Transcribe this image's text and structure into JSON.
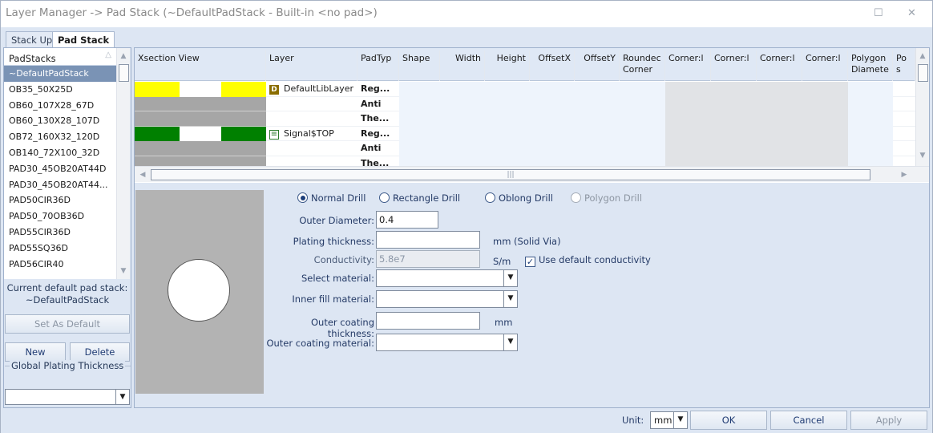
{
  "window": {
    "title": "Layer Manager -> Pad Stack (~DefaultPadStack - Built-in <no pad>)",
    "minimize_icon": "minimize-icon",
    "close_icon": "close-icon"
  },
  "tabs": [
    {
      "label": "Stack Up",
      "active": false
    },
    {
      "label": "Pad Stack",
      "active": true
    }
  ],
  "padstacks": {
    "header": "PadStacks",
    "items": [
      "~DefaultPadStack",
      "OB35_50X25D",
      "OB60_107X28_67D",
      "OB60_130X28_107D",
      "OB72_160X32_120D",
      "OB140_72X100_32D",
      "PAD30_45OB20AT44D",
      "PAD30_45OB20AT44...",
      "PAD50CIR36D",
      "PAD50_70OB36D",
      "PAD55CIR36D",
      "PAD55SQ36D",
      "PAD56CIR40"
    ],
    "selected_index": 0,
    "current_default_label": "Current default pad stack:",
    "current_default_value": "~DefaultPadStack",
    "set_default_label": "Set As Default",
    "new_label": "New",
    "delete_label": "Delete",
    "global_plating_label": "Global Plating Thickness",
    "global_plating_value": ""
  },
  "grid": {
    "columns": [
      "Xsection View",
      "Layer",
      "PadTyp",
      "Shape",
      "Width",
      "Height",
      "OffsetX",
      "OffsetY",
      "Roundec Corner",
      "Corner:l",
      "Corner:l",
      "Corner:l",
      "Corner:l",
      "Polygon Diamete",
      "Po s"
    ],
    "rows": [
      {
        "layer": "DefaultLibLayer",
        "layer_badge": "D",
        "padtype": "Reg...",
        "xsection_color": "#ffff00"
      },
      {
        "layer": "",
        "layer_badge": "",
        "padtype": "Anti",
        "xsection_color": "#a6a6a6"
      },
      {
        "layer": "",
        "layer_badge": "",
        "padtype": "The...",
        "xsection_color": "#a6a6a6"
      },
      {
        "layer": "Signal$TOP",
        "layer_badge": "≡",
        "padtype": "Reg...",
        "xsection_color": "#008000"
      },
      {
        "layer": "",
        "layer_badge": "",
        "padtype": "Anti",
        "xsection_color": "#a6a6a6"
      },
      {
        "layer": "",
        "layer_badge": "",
        "padtype": "The...",
        "xsection_color": "#a6a6a6"
      }
    ]
  },
  "drill": {
    "options": [
      {
        "label": "Normal Drill",
        "checked": true,
        "enabled": true
      },
      {
        "label": "Rectangle Drill",
        "checked": false,
        "enabled": true
      },
      {
        "label": "Oblong Drill",
        "checked": false,
        "enabled": true
      },
      {
        "label": "Polygon Drill",
        "checked": false,
        "enabled": false
      }
    ],
    "outer_diameter_label": "Outer Diameter:",
    "outer_diameter_value": "0.4",
    "plating_label": "Plating thickness:",
    "plating_value": "",
    "plating_unit": "mm (Solid Via)",
    "conductivity_label": "Conductivity:",
    "conductivity_value": "5.8e7",
    "conductivity_unit": "S/m",
    "use_default_conductivity_label": "Use default conductivity",
    "use_default_conductivity_checked": true,
    "select_material_label": "Select material:",
    "select_material_value": "",
    "inner_fill_label": "Inner fill material:",
    "inner_fill_value": "",
    "outer_coating_thickness_label": "Outer coating thickness:",
    "outer_coating_thickness_value": "",
    "outer_coating_thickness_unit": "mm",
    "outer_coating_material_label": "Outer coating material:",
    "outer_coating_material_value": ""
  },
  "footer": {
    "unit_label": "Unit:",
    "unit_value": "mm",
    "ok_label": "OK",
    "cancel_label": "Cancel",
    "apply_label": "Apply"
  }
}
